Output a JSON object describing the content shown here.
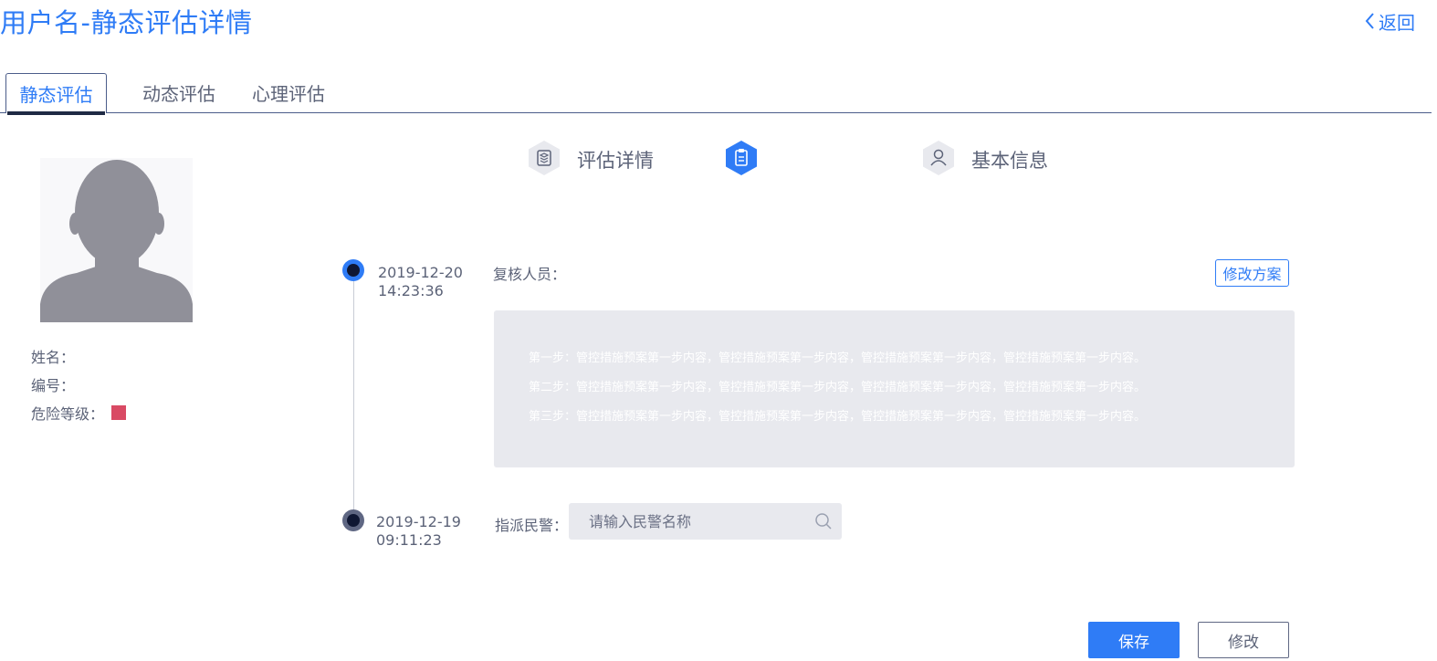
{
  "header": {
    "title": "用户名-静态评估详情",
    "back_label": "返回",
    "back_icon": "chevron-left-icon"
  },
  "tabs": [
    {
      "label": "静态评估",
      "active": true
    },
    {
      "label": "动态评估",
      "active": false
    },
    {
      "label": "心理评估",
      "active": false
    }
  ],
  "profile": {
    "avatar_icon": "user-silhouette-icon",
    "name_label": "姓名：",
    "id_label": "编号：",
    "risk_label": "危险等级：",
    "risk_color": "#d94a64"
  },
  "steps": [
    {
      "label": "评估详情",
      "icon": "layers-icon",
      "active": false
    },
    {
      "label": "",
      "icon": "clipboard-icon",
      "active": true
    },
    {
      "label": "基本信息",
      "icon": "user-icon",
      "active": false
    }
  ],
  "timeline": {
    "entries": [
      {
        "date": "2019-12-20",
        "time": "14:23:36",
        "reviewer_label": "复核人员：",
        "edit_plan_label": "修改方案",
        "plan_lines": [
          "第一步：管控措施预案第一步内容，管控措施预案第一步内容，管控措施预案第一步内容，管控措施预案第一步内容。",
          "第二步：管控措施预案第一步内容，管控措施预案第一步内容，管控措施预案第一步内容，管控措施预案第一步内容。",
          "第三步：管控措施预案第一步内容，管控措施预案第一步内容，管控措施预案第一步内容，管控措施预案第一步内容。"
        ]
      },
      {
        "date": "2019-12-19",
        "time": "09:11:23",
        "assign_label": "指派民警：",
        "assign_placeholder": "请输入民警名称",
        "assign_value": ""
      }
    ]
  },
  "actions": {
    "save_label": "保存",
    "edit_label": "修改"
  },
  "colors": {
    "accent": "#2f7cf6",
    "text": "#5c6378",
    "panel": "#e8e9ee"
  }
}
